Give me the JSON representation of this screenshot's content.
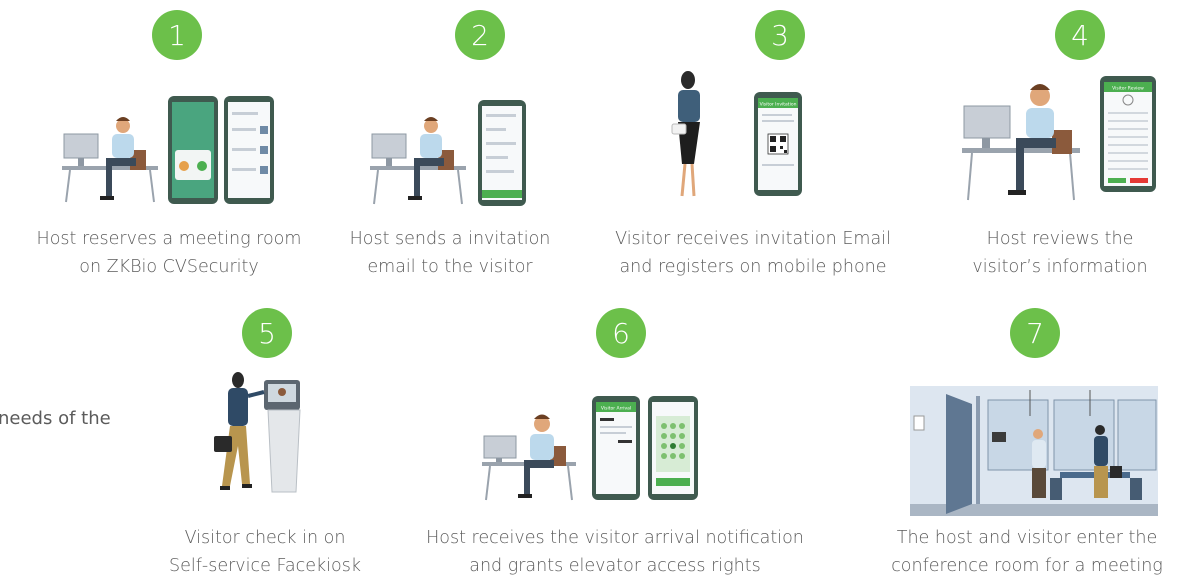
{
  "background_fragment": "needs of the",
  "steps": [
    {
      "number": "1",
      "line1": "Host reserves a meeting room",
      "line2": "on ZKBio CVSecurity"
    },
    {
      "number": "2",
      "line1": "Host sends a invitation",
      "line2": "email to the visitor"
    },
    {
      "number": "3",
      "line1": "Visitor receives invitation Email",
      "line2": "and registers on mobile phone"
    },
    {
      "number": "4",
      "line1": "Host reviews the",
      "line2": "visitor’s information"
    },
    {
      "number": "5",
      "line1": "Visitor check in on",
      "line2": "Self-service Facekiosk"
    },
    {
      "number": "6",
      "line1": "Host receives the visitor arrival notification",
      "line2": "and grants elevator access rights"
    },
    {
      "number": "7",
      "line1": "The host and visitor enter the",
      "line2": "conference room for a meeting"
    }
  ],
  "phone_screens": {
    "invitation_title": "Visitor Invitation",
    "review_title": "Visitor Review",
    "arrival_title": "Visitor Arrival"
  },
  "colors": {
    "badge_green": "#6cc04a",
    "phone_frame": "#3f5a4f",
    "screen_green": "#4caf50",
    "text_gray": "#5b5b5b"
  }
}
